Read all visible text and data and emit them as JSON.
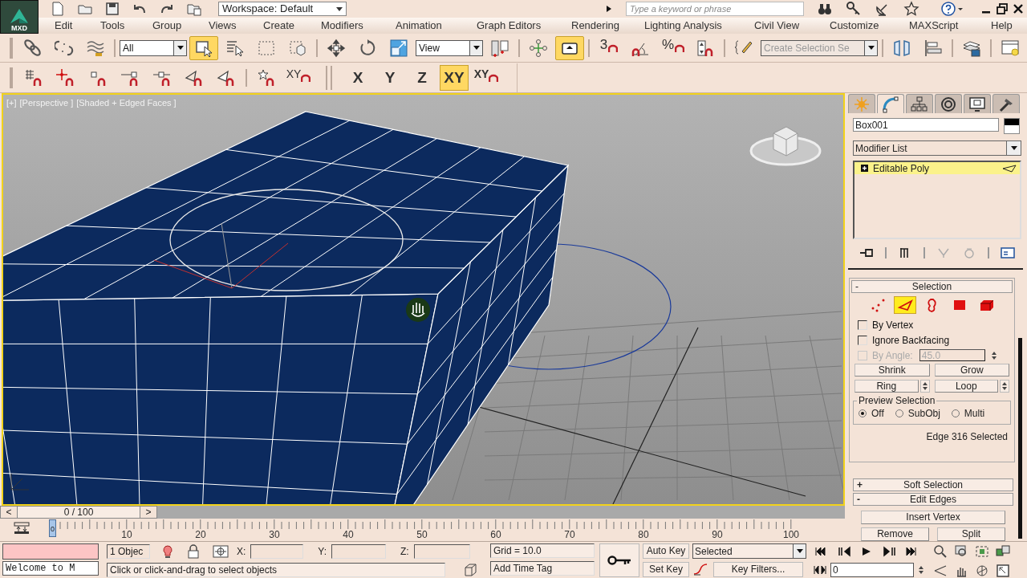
{
  "app": {
    "logo": "MXD",
    "workspace": "Workspace: Default",
    "search_placeholder": "Type a keyword or phrase"
  },
  "menu": [
    "Edit",
    "Tools",
    "Group",
    "Views",
    "Create",
    "Modifiers",
    "Animation",
    "Graph Editors",
    "Rendering",
    "Lighting Analysis",
    "Civil View",
    "Customize",
    "MAXScript",
    "Help"
  ],
  "toolbar_main": [
    {
      "kind": "button",
      "selected": false
    },
    {
      "kind": "button",
      "selected": false
    },
    {
      "kind": "button",
      "selected": false
    },
    {
      "kind": "separator"
    },
    {
      "kind": "dropdown",
      "value": "All"
    },
    {
      "kind": "button",
      "selected": true
    },
    {
      "kind": "button",
      "selected": false
    },
    {
      "kind": "button",
      "selected": false
    },
    {
      "kind": "button",
      "selected": false
    },
    {
      "kind": "separator"
    },
    {
      "kind": "button",
      "selected": false
    },
    {
      "kind": "button",
      "selected": false
    },
    {
      "kind": "button",
      "selected": false
    },
    {
      "kind": "dropdown",
      "value": "View"
    },
    {
      "kind": "button",
      "selected": false
    },
    {
      "kind": "separator"
    },
    {
      "kind": "button",
      "selected": false
    },
    {
      "kind": "button",
      "selected": true
    },
    {
      "kind": "separator"
    },
    {
      "kind": "snap",
      "label": "3",
      "selected": false
    },
    {
      "kind": "button",
      "selected": false
    },
    {
      "kind": "snap",
      "label": "%",
      "selected": false
    },
    {
      "kind": "button",
      "selected": false
    },
    {
      "kind": "separator"
    },
    {
      "kind": "button",
      "selected": false
    },
    {
      "kind": "dropdown",
      "placeholder": "Create Selection Se"
    },
    {
      "kind": "separator"
    },
    {
      "kind": "button",
      "selected": false
    },
    {
      "kind": "button",
      "selected": false
    },
    {
      "kind": "separator"
    },
    {
      "kind": "button",
      "selected": false
    },
    {
      "kind": "separator"
    },
    {
      "kind": "button",
      "selected": false
    }
  ],
  "toolbar_snaps": [
    {
      "kind": "snap"
    },
    {
      "kind": "snap"
    },
    {
      "kind": "snap"
    },
    {
      "kind": "snap"
    },
    {
      "kind": "snap"
    },
    {
      "kind": "snap"
    },
    {
      "kind": "snap"
    },
    {
      "kind": "separator"
    },
    {
      "kind": "snap"
    },
    {
      "kind": "snap",
      "label": "XY"
    }
  ],
  "axis_constraints": [
    {
      "kind": "axis",
      "label": "X",
      "selected": false
    },
    {
      "kind": "axis",
      "label": "Y",
      "selected": false
    },
    {
      "kind": "axis",
      "label": "Z",
      "selected": false
    },
    {
      "kind": "axis",
      "label": "XY",
      "selected": true
    },
    {
      "kind": "snap",
      "label": "XY",
      "selected": false
    }
  ],
  "viewport": {
    "labels": [
      "[+]",
      "[Perspective ]",
      "[Shaded + Edged Faces ]"
    ]
  },
  "command_panel": {
    "tabs": [
      {
        "selected": false
      },
      {
        "selected": true
      },
      {
        "selected": false
      },
      {
        "selected": false
      },
      {
        "selected": false
      },
      {
        "selected": false
      }
    ],
    "object_name": "Box001",
    "modifier_list": "Modifier List",
    "stack": [
      {
        "label": "Editable Poly",
        "selected": true
      }
    ],
    "selection": {
      "sign": "-",
      "title": "Selection",
      "levels": [
        {
          "selected": false
        },
        {
          "selected": true
        },
        {
          "selected": false
        },
        {
          "selected": false
        },
        {
          "selected": false
        }
      ],
      "options": [
        {
          "label": "By Vertex",
          "checked": false,
          "disabled": false
        },
        {
          "label": "Ignore Backfacing",
          "checked": false,
          "disabled": false
        },
        {
          "label": "By Angle:",
          "checked": false,
          "disabled": true,
          "value": "45.0"
        }
      ],
      "buttons": [
        "Shrink",
        "Grow",
        "Ring",
        "Loop"
      ],
      "preview": {
        "title": "Preview Selection",
        "options": [
          {
            "label": "Off",
            "selected": true
          },
          {
            "label": "SubObj",
            "selected": false
          },
          {
            "label": "Multi",
            "selected": false
          }
        ]
      },
      "status": "Edge 316 Selected"
    },
    "rollouts": [
      {
        "sign": "+",
        "title": "Soft Selection"
      },
      {
        "sign": "-",
        "title": "Edit Edges",
        "buttons": [
          "Insert Vertex",
          "Remove",
          "Split"
        ]
      }
    ]
  },
  "time_slider": {
    "label": "0 / 100",
    "prev": "<",
    "next": ">"
  },
  "track": {
    "ticks": [
      "10",
      "20",
      "30",
      "40",
      "50",
      "60",
      "70",
      "80",
      "90",
      "100"
    ],
    "current": "0"
  },
  "status_bar": {
    "listener": "Welcome to M",
    "selection_count": "1 Objec",
    "x_label": "X:",
    "y_label": "Y:",
    "z_label": "Z:",
    "grid": "Grid = 10.0",
    "prompt": "Click or click-and-drag to select objects",
    "time_tag": "Add Time Tag",
    "auto_key": "Auto Key",
    "set_key": "Set Key",
    "key_set": "Selected",
    "key_filters": "Key Filters...",
    "frame": "0"
  }
}
